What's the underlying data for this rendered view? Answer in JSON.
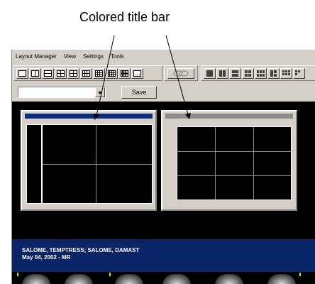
{
  "annotation": {
    "label": "Colored title bar"
  },
  "menubar": {
    "items": [
      "Layout Manager",
      "View",
      "Settings",
      "Tools"
    ]
  },
  "toolbar": {
    "layout_buttons": [
      "1x1",
      "1x2",
      "2x1",
      "2x2",
      "2x2",
      "2x3",
      "3x3",
      "3x4",
      "more"
    ],
    "arrange_buttons": [
      "1",
      "2",
      "3",
      "4",
      "5",
      "6",
      "7"
    ]
  },
  "layout_select": {
    "value": ""
  },
  "save": {
    "label": "Save"
  },
  "panels": [
    {
      "title_color": "#0a2d80"
    },
    {
      "title_color": "#8c8c8c"
    }
  ],
  "patient": {
    "name": "SALOME, TEMPTRESS; SALOME, DAMAST",
    "date_modality": "May 04, 2002 - MR"
  },
  "colors": {
    "workspace": "#000000",
    "chrome": "#d4d0c8",
    "patient_band": "#0a2468",
    "active_title": "#0a2d80",
    "inactive_title": "#8c8c8c"
  }
}
